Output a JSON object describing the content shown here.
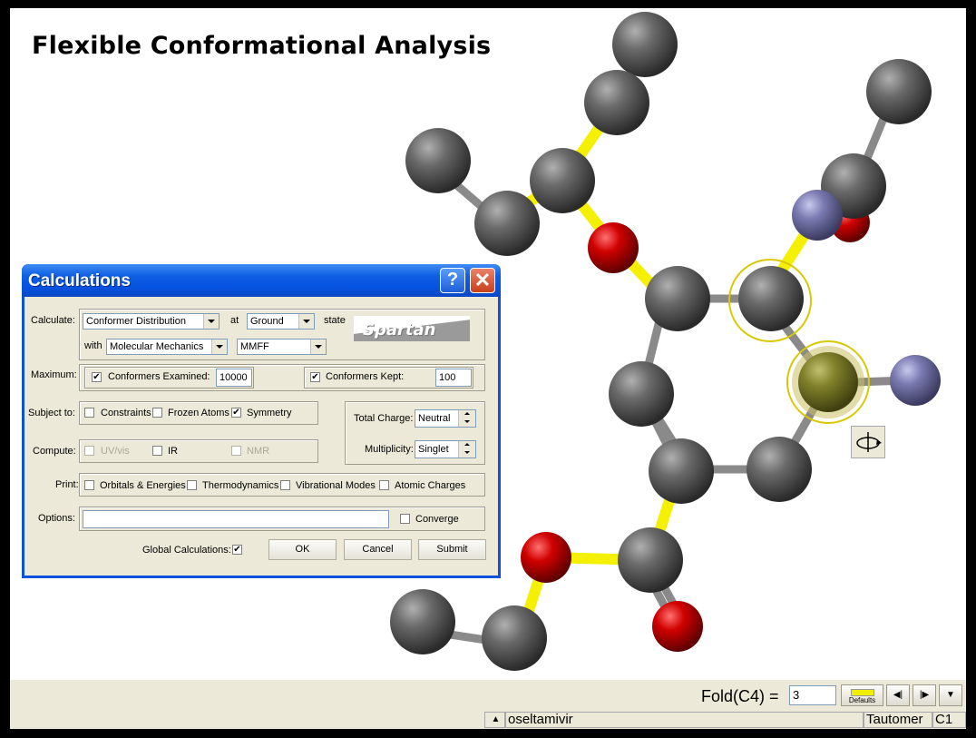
{
  "slide": {
    "title": "Flexible Conformational Analysis"
  },
  "dialog": {
    "title": "Calculations",
    "help_label": "?",
    "close_label": "✕",
    "calculate": {
      "label": "Calculate:",
      "method": "Conformer Distribution",
      "at_label": "at",
      "state": "Ground",
      "state_label": "state",
      "with_label": "with",
      "level": "Molecular Mechanics",
      "forcefield": "MMFF",
      "logo_text": "Spartan"
    },
    "maximum": {
      "label": "Maximum:",
      "examined_label": "Conformers Examined:",
      "examined_checked": "✔",
      "examined_value": "10000",
      "kept_label": "Conformers Kept:",
      "kept_checked": "✔",
      "kept_value": "100"
    },
    "subject": {
      "label": "Subject to:",
      "constraints": "Constraints",
      "frozen": "Frozen Atoms",
      "symmetry": "Symmetry",
      "symmetry_checked": "✔"
    },
    "charge": {
      "total_label": "Total Charge:",
      "total_value": "Neutral",
      "mult_label": "Multiplicity:",
      "mult_value": "Singlet"
    },
    "compute": {
      "label": "Compute:",
      "uvvis": "UV/vis",
      "ir": "IR",
      "nmr": "NMR"
    },
    "print": {
      "label": "Print:",
      "orbitals": "Orbitals & Energies",
      "thermo": "Thermodynamics",
      "vibrational": "Vibrational Modes",
      "atomic": "Atomic Charges"
    },
    "options": {
      "label": "Options:",
      "value": "",
      "converge": "Converge"
    },
    "footer": {
      "global_label": "Global Calculations:",
      "global_checked": "✔",
      "ok": "OK",
      "cancel": "Cancel",
      "submit": "Submit"
    }
  },
  "toolbar": {
    "fold_label": "Fold(C4) =",
    "fold_value": "3",
    "defaults_label": "Defaults",
    "prev_label": "◀|",
    "next_label": "|▶",
    "menu_label": "▼"
  },
  "status": {
    "up_arrow": "▲",
    "molecule_name": "oseltamivir",
    "tautomer": "Tautomer",
    "point_group": "C1"
  },
  "colors": {
    "carbon": "#5a5a5a",
    "oxygen": "#c80000",
    "nitrogen": "#7a7aa8",
    "selected_atom": "#8a8a30",
    "rotatable_bond": "#f4f000",
    "xp_title_blue": "#0a52d8"
  }
}
